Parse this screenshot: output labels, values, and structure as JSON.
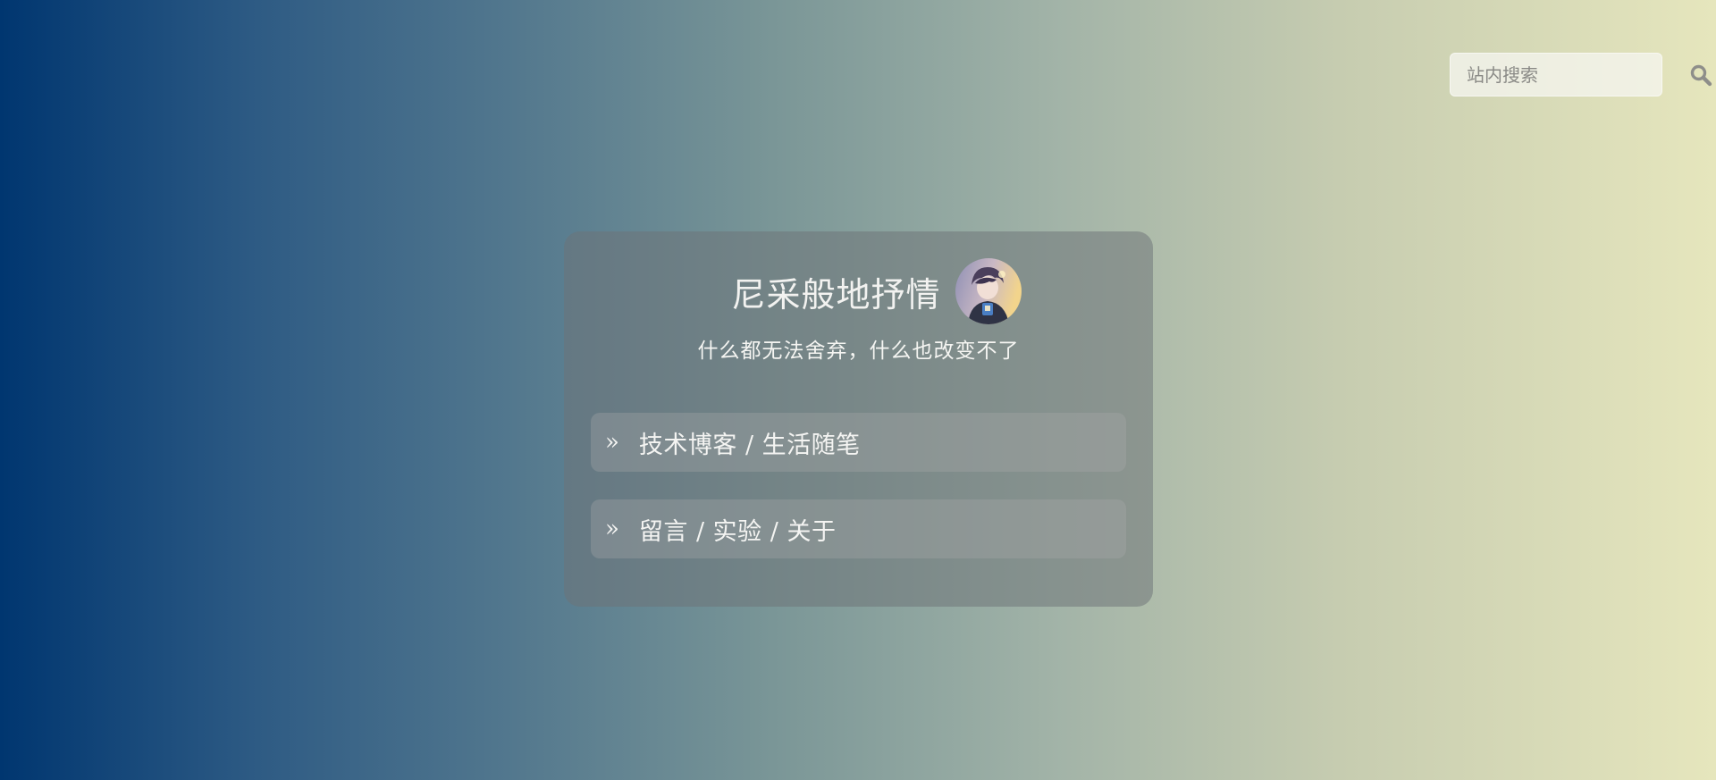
{
  "search": {
    "placeholder": "站内搜索",
    "value": ""
  },
  "profile": {
    "title": "尼采般地抒情",
    "subtitle": "什么都无法舍弃，什么也改变不了",
    "avatar_icon": "avatar-image"
  },
  "nav": {
    "arrow": "»",
    "items": [
      {
        "label": "技术博客 / 生活随笔"
      },
      {
        "label": "留言 / 实验 / 关于"
      }
    ]
  },
  "colors": {
    "gradient_start": "#003670",
    "gradient_end": "#e6e6bd",
    "text": "#f2f2f0"
  }
}
